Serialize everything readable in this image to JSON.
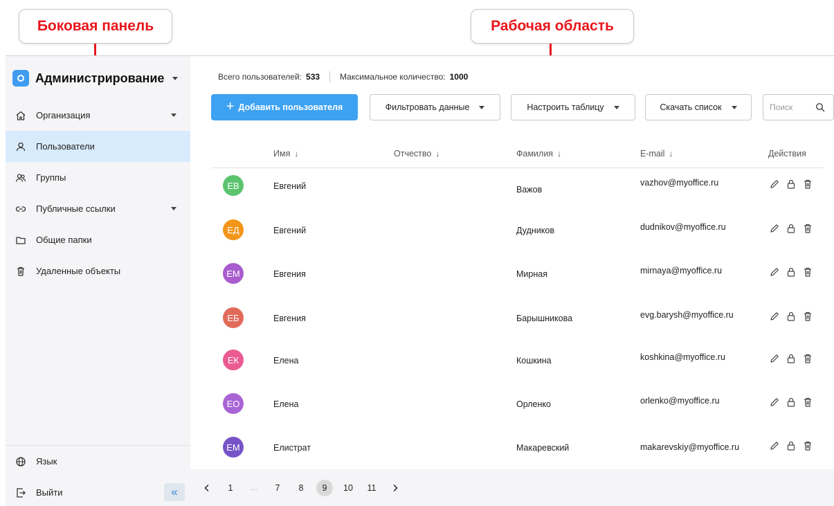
{
  "callouts": {
    "sidebar": "Боковая панель",
    "workspace": "Рабочая область"
  },
  "sidebar": {
    "title": "Администрирование",
    "items": [
      {
        "label": "Организация",
        "icon": "home-icon",
        "has_caret": true
      },
      {
        "label": "Пользователи",
        "icon": "user-icon",
        "active": true
      },
      {
        "label": "Группы",
        "icon": "group-icon"
      },
      {
        "label": "Публичные ссылки",
        "icon": "link-icon",
        "has_caret": true
      },
      {
        "label": "Общие папки",
        "icon": "folder-icon"
      },
      {
        "label": "Удаленные объекты",
        "icon": "trash-icon"
      }
    ],
    "bottom": [
      {
        "label": "Язык",
        "icon": "globe-icon"
      },
      {
        "label": "Выйти",
        "icon": "logout-icon"
      }
    ],
    "collapse_glyph": "«"
  },
  "stats": {
    "total_label": "Всего пользователей:",
    "total_value": "533",
    "max_label": "Максимальное количество:",
    "max_value": "1000"
  },
  "toolbar": {
    "add_label": "Добавить пользователя",
    "filter_label": "Фильтровать данные",
    "configure_label": "Настроить таблицу",
    "download_label": "Скачать список",
    "search_placeholder": "Поиск"
  },
  "table": {
    "columns": {
      "name": "Имя",
      "patronymic": "Отчество",
      "surname": "Фамилия",
      "email": "E-mail",
      "actions": "Действия"
    },
    "sort_arrow": "↓",
    "rows": [
      {
        "initials": "ЕВ",
        "color": "#5cc46e",
        "name": "Евгений",
        "patronymic": "",
        "surname": "Важов",
        "email": "vazhov@myoffice.ru"
      },
      {
        "initials": "ЕД",
        "color": "#f39518",
        "name": "Евгений",
        "patronymic": "",
        "surname": "Дудников",
        "email": "dudnikov@myoffice.ru"
      },
      {
        "initials": "ЕМ",
        "color": "#a95ccf",
        "name": "Евгения",
        "patronymic": "",
        "surname": "Мирная",
        "email": "mirnaya@myoffice.ru"
      },
      {
        "initials": "ЕБ",
        "color": "#e26a5a",
        "name": "Евгения",
        "patronymic": "",
        "surname": "Барышникова",
        "email": "evg.barysh@myoffice.ru"
      },
      {
        "initials": "ЕК",
        "color": "#ea5b91",
        "name": "Елена",
        "patronymic": "",
        "surname": "Кошкина",
        "email": "koshkina@myoffice.ru"
      },
      {
        "initials": "ЕО",
        "color": "#a964d6",
        "name": "Елена",
        "patronymic": "",
        "surname": "Орленко",
        "email": "orlenko@myoffice.ru"
      },
      {
        "initials": "ЕМ",
        "color": "#7654c7",
        "name": "Елистрат",
        "patronymic": "",
        "surname": "Макаревский",
        "email": "makarevskiy@myoffice.ru"
      }
    ]
  },
  "pagination": {
    "pages": [
      "1",
      "…",
      "7",
      "8",
      "9",
      "10",
      "11"
    ],
    "current": "9"
  },
  "colors": {
    "accent": "#3ea2f2",
    "callout_red": "#e8151b",
    "sidebar_bg": "#f5f5f7",
    "active_item_bg": "#d8ebfc"
  }
}
